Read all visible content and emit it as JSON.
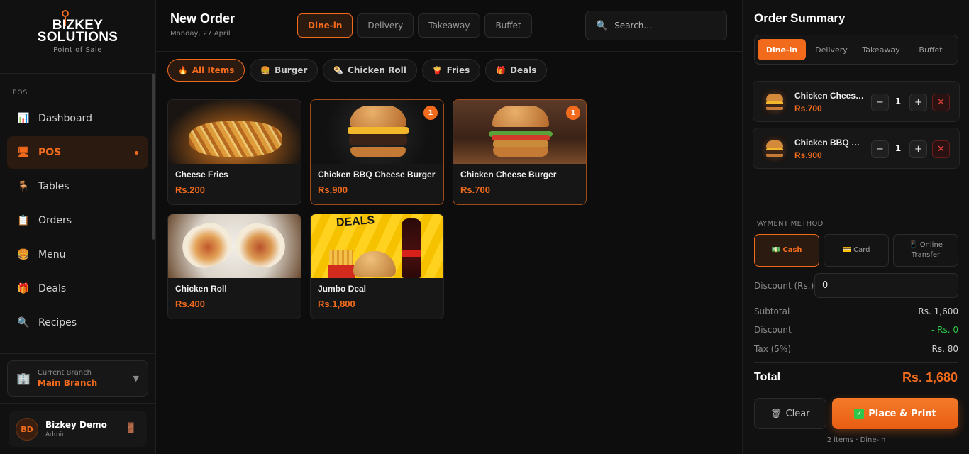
{
  "brand": {
    "line1": "BIZKEY",
    "line2": "SOLUTIONS",
    "sub": "Point of Sale"
  },
  "sidebar": {
    "section": "POS",
    "items": [
      {
        "label": "Dashboard",
        "icon": "chart-icon"
      },
      {
        "label": "POS",
        "icon": "monitor-icon"
      },
      {
        "label": "Tables",
        "icon": "table-icon"
      },
      {
        "label": "Orders",
        "icon": "clipboard-icon"
      },
      {
        "label": "Menu",
        "icon": "burger-icon"
      },
      {
        "label": "Deals",
        "icon": "gift-icon"
      },
      {
        "label": "Recipes",
        "icon": "magnifier-icon"
      }
    ],
    "branch": {
      "label": "Current Branch",
      "value": "Main Branch"
    },
    "user": {
      "initials": "BD",
      "name": "Bizkey Demo",
      "role": "Admin"
    }
  },
  "header": {
    "title": "New Order",
    "date": "Monday, 27 April",
    "order_types": [
      "Dine-in",
      "Delivery",
      "Takeaway",
      "Buffet"
    ],
    "active_type": "Dine-in",
    "search_placeholder": "Search..."
  },
  "categories": [
    {
      "label": "All Items",
      "icon": "fire-icon",
      "active": true
    },
    {
      "label": "Burger",
      "icon": "burger-icon",
      "active": false
    },
    {
      "label": "Chicken Roll",
      "icon": "roll-icon",
      "active": false
    },
    {
      "label": "Fries",
      "icon": "fries-icon",
      "active": false
    },
    {
      "label": "Deals",
      "icon": "gift-icon",
      "active": false
    }
  ],
  "products": [
    {
      "name": "Cheese Fries",
      "price": "Rs.200",
      "qty": null
    },
    {
      "name": "Chicken BBQ Cheese Burger",
      "price": "Rs.900",
      "qty": "1"
    },
    {
      "name": "Chicken Cheese Burger",
      "price": "Rs.700",
      "qty": "1"
    },
    {
      "name": "Chicken Roll",
      "price": "Rs.400",
      "qty": null
    },
    {
      "name": "Jumbo Deal",
      "price": "Rs.1,800",
      "qty": null,
      "image_text": "DEALS"
    }
  ],
  "summary": {
    "title": "Order Summary",
    "order_types": [
      "Dine-in",
      "Delivery",
      "Takeaway",
      "Buffet"
    ],
    "items": [
      {
        "name": "Chicken Cheese Burger",
        "price": "Rs.700",
        "qty": "1"
      },
      {
        "name": "Chicken BBQ Cheese Burger",
        "price": "Rs.900",
        "qty": "1"
      }
    ],
    "payment_label": "PAYMENT METHOD",
    "payment_methods": [
      "Cash",
      "Card",
      "Online",
      "Transfer"
    ],
    "discount_label": "Discount (Rs.)",
    "discount_value": "0",
    "subtotal_label": "Subtotal",
    "subtotal_value": "Rs. 1,600",
    "discount_line_label": "Discount",
    "discount_line_value": "- Rs. 0",
    "tax_label": "Tax (5%)",
    "tax_value": "Rs. 80",
    "total_label": "Total",
    "total_value": "Rs. 1,680",
    "clear_label": "Clear",
    "place_label": "Place & Print",
    "footer": "2 items · Dine-in"
  },
  "colors": {
    "accent": "#f26b1d",
    "success": "#2ec74a",
    "danger": "#e0443a",
    "bg": "#0d0d0d",
    "panel": "#111111"
  }
}
